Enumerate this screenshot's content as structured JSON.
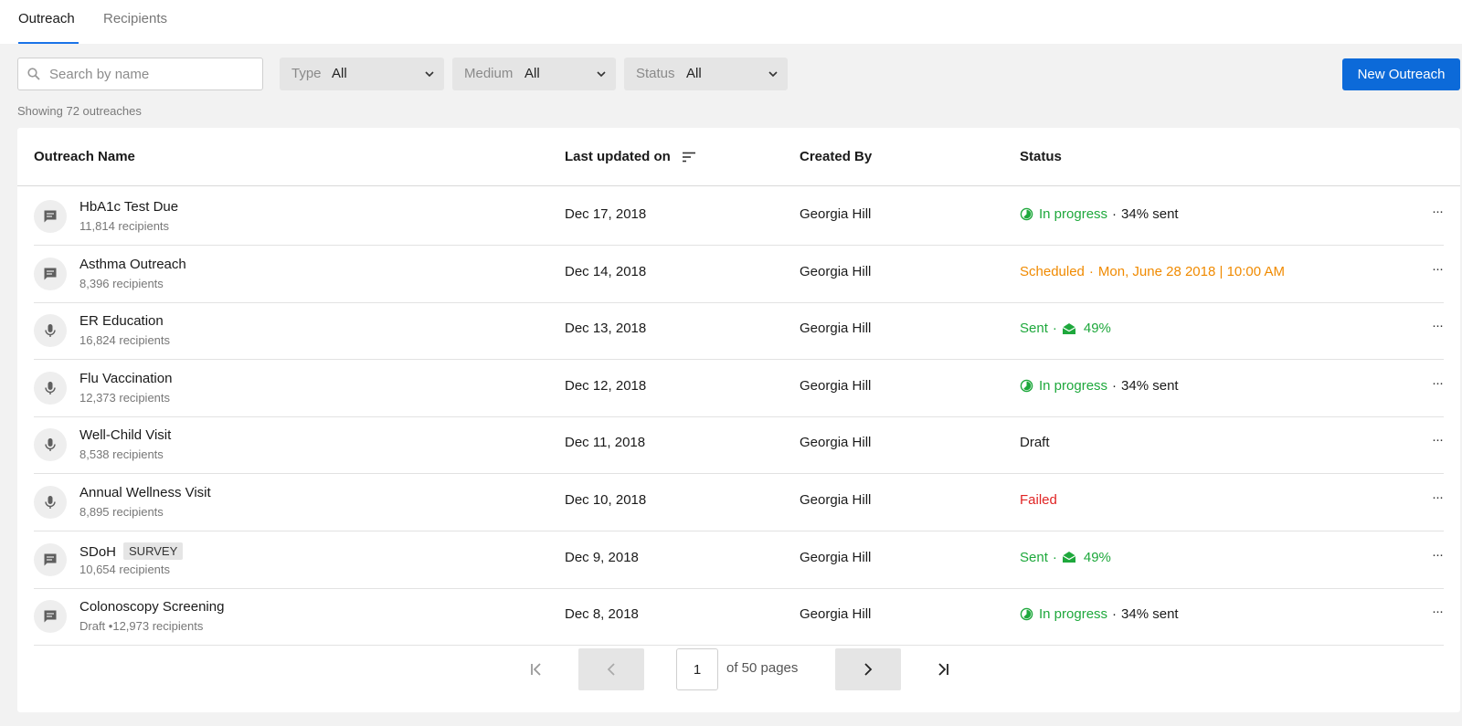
{
  "tabs": [
    {
      "label": "Outreach",
      "active": true
    },
    {
      "label": "Recipients",
      "active": false
    }
  ],
  "toolbar": {
    "search_placeholder": "Search by name",
    "filters": [
      {
        "label": "Type",
        "value": "All"
      },
      {
        "label": "Medium",
        "value": "All"
      },
      {
        "label": "Status",
        "value": "All"
      }
    ],
    "new_button": "New Outreach"
  },
  "showing_text": "Showing 72 outreaches",
  "table": {
    "headers": {
      "name": "Outreach Name",
      "updated": "Last updated on",
      "created_by": "Created By",
      "status": "Status"
    },
    "rows": [
      {
        "icon": "message-icon",
        "name": "HbA1c Test Due",
        "badge": "",
        "sub": "11,814 recipients",
        "date": "Dec 17, 2018",
        "created_by": "Georgia Hill",
        "status_label": "In progress",
        "status_detail": "34% sent",
        "more": "···"
      },
      {
        "icon": "message-icon",
        "name": "Asthma Outreach",
        "badge": "",
        "sub": "8,396 recipients",
        "date": "Dec 14, 2018",
        "created_by": "Georgia Hill",
        "status_label": "Scheduled",
        "status_detail": "Mon, June 28 2018 | 10:00 AM",
        "more": "···"
      },
      {
        "icon": "mic-icon",
        "name": "ER Education",
        "badge": "",
        "sub": "16,824 recipients",
        "date": "Dec 13, 2018",
        "created_by": "Georgia Hill",
        "status_label": "Sent",
        "status_detail": "49%",
        "more": "···"
      },
      {
        "icon": "mic-icon",
        "name": "Flu Vaccination",
        "badge": "",
        "sub": "12,373 recipients",
        "date": "Dec 12, 2018",
        "created_by": "Georgia Hill",
        "status_label": "In progress",
        "status_detail": "34% sent",
        "more": "···"
      },
      {
        "icon": "mic-icon",
        "name": "Well-Child Visit",
        "badge": "",
        "sub": "8,538 recipients",
        "date": "Dec 11, 2018",
        "created_by": "Georgia Hill",
        "status_label": "Draft",
        "status_detail": "",
        "more": "···"
      },
      {
        "icon": "mic-icon",
        "name": "Annual Wellness Visit",
        "badge": "",
        "sub": "8,895 recipients",
        "date": "Dec 10, 2018",
        "created_by": "Georgia Hill",
        "status_label": "Failed",
        "status_detail": "",
        "more": "···"
      },
      {
        "icon": "message-icon",
        "name": "SDoH",
        "badge": "SURVEY",
        "sub": "10,654 recipients",
        "date": "Dec 9, 2018",
        "created_by": "Georgia Hill",
        "status_label": "Sent",
        "status_detail": "49%",
        "more": "···"
      },
      {
        "icon": "message-icon",
        "name": "Colonoscopy Screening",
        "badge": "",
        "sub": " Draft  •12,973 recipients",
        "date": "Dec 8, 2018",
        "created_by": "Georgia Hill",
        "status_label": "In progress",
        "status_detail": "34% sent",
        "more": "···"
      }
    ]
  },
  "pagination": {
    "current_page": "1",
    "of_text": "of 50 pages"
  },
  "colors": {
    "accent": "#0c6ad9",
    "in_progress": "#1ea83c",
    "scheduled": "#f08a00",
    "failed": "#e02424"
  }
}
